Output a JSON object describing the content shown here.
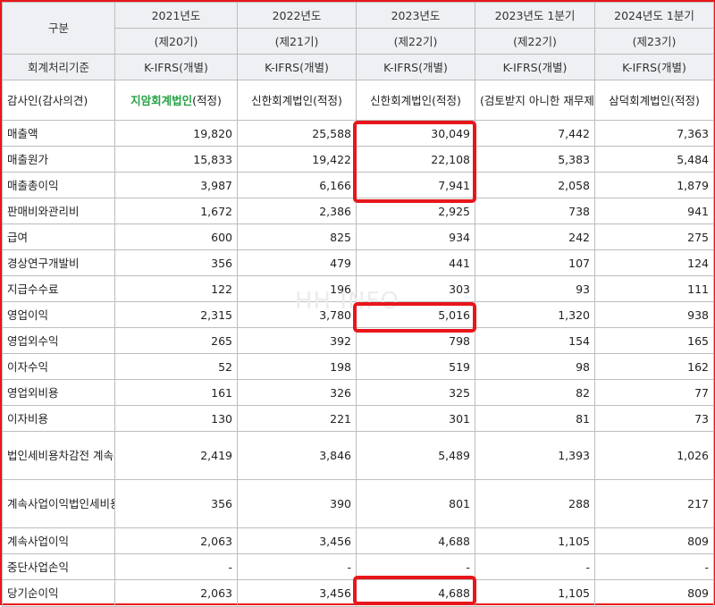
{
  "watermark": "HH INFO",
  "header": {
    "category_label": "구분",
    "standard_label": "회계처리기준",
    "auditor_label": "감사인(감사의견)",
    "years": [
      "2021년도",
      "2022년도",
      "2023년도",
      "2023년도 1분기",
      "2024년도 1분기"
    ],
    "periods": [
      "(제20기)",
      "(제21기)",
      "(제22기)",
      "(제22기)",
      "(제23기)"
    ],
    "standards": [
      "K-IFRS(개별)",
      "K-IFRS(개별)",
      "K-IFRS(개별)",
      "K-IFRS(개별)",
      "K-IFRS(개별)"
    ],
    "auditor_2021": {
      "name": "지암회계법인",
      "opinion": "(적정)"
    },
    "auditors": [
      "신한회계법인(적정)",
      "신한회계법인(적정)",
      "(검토받지 아니한 재무제표)",
      "삼덕회계법인(적정)"
    ]
  },
  "rows": [
    {
      "label": "매출액",
      "values": [
        "19,820",
        "25,588",
        "30,049",
        "7,442",
        "7,363"
      ]
    },
    {
      "label": "매출원가",
      "values": [
        "15,833",
        "19,422",
        "22,108",
        "5,383",
        "5,484"
      ]
    },
    {
      "label": "매출총이익",
      "values": [
        "3,987",
        "6,166",
        "7,941",
        "2,058",
        "1,879"
      ]
    },
    {
      "label": "판매비와관리비",
      "values": [
        "1,672",
        "2,386",
        "2,925",
        "738",
        "941"
      ]
    },
    {
      "label": "급여",
      "values": [
        "600",
        "825",
        "934",
        "242",
        "275"
      ]
    },
    {
      "label": "경상연구개발비",
      "values": [
        "356",
        "479",
        "441",
        "107",
        "124"
      ]
    },
    {
      "label": "지급수수료",
      "values": [
        "122",
        "196",
        "303",
        "93",
        "111"
      ]
    },
    {
      "label": "영업이익",
      "values": [
        "2,315",
        "3,780",
        "5,016",
        "1,320",
        "938"
      ]
    },
    {
      "label": "영업외수익",
      "values": [
        "265",
        "392",
        "798",
        "154",
        "165"
      ]
    },
    {
      "label": "이자수익",
      "values": [
        "52",
        "198",
        "519",
        "98",
        "162"
      ]
    },
    {
      "label": "영업외비용",
      "values": [
        "161",
        "326",
        "325",
        "82",
        "77"
      ]
    },
    {
      "label": "이자비용",
      "values": [
        "130",
        "221",
        "301",
        "81",
        "73"
      ]
    },
    {
      "label": "법인세비용차감전 계속사업이익",
      "values": [
        "2,419",
        "3,846",
        "5,489",
        "1,393",
        "1,026"
      ]
    },
    {
      "label": "계속사업이익법인세비용",
      "values": [
        "356",
        "390",
        "801",
        "288",
        "217"
      ]
    },
    {
      "label": "계속사업이익",
      "values": [
        "2,063",
        "3,456",
        "4,688",
        "1,105",
        "809"
      ]
    },
    {
      "label": "중단사업손익",
      "values": [
        "-",
        "-",
        "-",
        "-",
        "-"
      ]
    },
    {
      "label": "당기순이익",
      "values": [
        "2,063",
        "3,456",
        "4,688",
        "1,105",
        "809"
      ]
    }
  ]
}
